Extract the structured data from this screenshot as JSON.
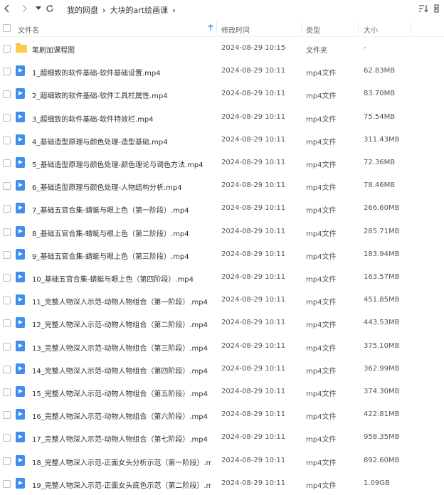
{
  "breadcrumb": [
    "我的网盘",
    "大块的art绘画课"
  ],
  "columns": {
    "name": "文件名",
    "modified": "修改时间",
    "type": "类型",
    "size": "大小"
  },
  "colors": {
    "accent": "#3f8ef0",
    "folder": "#ffcb4f"
  },
  "files": [
    {
      "icon": "folder-icon",
      "name": "笔刷加课程图",
      "time": "2024-08-29 10:15",
      "type": "文件夹",
      "size": "-"
    },
    {
      "icon": "mp4-icon",
      "name": "1_超细致的软件基础-软件基础设置.mp4",
      "time": "2024-08-29 10:11",
      "type": "mp4文件",
      "size": "62.83MB"
    },
    {
      "icon": "mp4-icon",
      "name": "2_超细致的软件基础-软件工具栏属性.mp4",
      "time": "2024-08-29 10:11",
      "type": "mp4文件",
      "size": "83.70MB"
    },
    {
      "icon": "mp4-icon",
      "name": "3_超细致的软件基础-软件特效栏.mp4",
      "time": "2024-08-29 10:11",
      "type": "mp4文件",
      "size": "75.54MB"
    },
    {
      "icon": "mp4-icon",
      "name": "4_基础造型原理与颜色处理-造型基础.mp4",
      "time": "2024-08-29 10:11",
      "type": "mp4文件",
      "size": "311.43MB"
    },
    {
      "icon": "mp4-icon",
      "name": "5_基础造型原理与颜色处理-颜色理论与调色方法.mp4",
      "time": "2024-08-29 10:11",
      "type": "mp4文件",
      "size": "72.36MB"
    },
    {
      "icon": "mp4-icon",
      "name": "6_基础造型原理与颜色处理-人物结构分析.mp4",
      "time": "2024-08-29 10:11",
      "type": "mp4文件",
      "size": "78.46MB"
    },
    {
      "icon": "mp4-icon",
      "name": "7_基础五官合集-蜻蜓与眼上色（第一阶段）.mp4",
      "time": "2024-08-29 10:11",
      "type": "mp4文件",
      "size": "266.60MB"
    },
    {
      "icon": "mp4-icon",
      "name": "8_基础五官合集-蜻蜓与眼上色（第二阶段）.mp4",
      "time": "2024-08-29 10:11",
      "type": "mp4文件",
      "size": "285.71MB"
    },
    {
      "icon": "mp4-icon",
      "name": "9_基础五官合集-蜻蜓与眼上色（第三阶段）.mp4",
      "time": "2024-08-29 10:11",
      "type": "mp4文件",
      "size": "183.94MB"
    },
    {
      "icon": "mp4-icon",
      "name": "10_基础五官合集-蜻蜓与眼上色（第四阶段）.mp4",
      "time": "2024-08-29 10:11",
      "type": "mp4文件",
      "size": "163.57MB"
    },
    {
      "icon": "mp4-icon",
      "name": "11_完整人物深入示范-动物人物组合（第一阶段）.mp4",
      "time": "2024-08-29 10:11",
      "type": "mp4文件",
      "size": "451.85MB"
    },
    {
      "icon": "mp4-icon",
      "name": "12_完整人物深入示范-动物人物组合（第二阶段）.mp4",
      "time": "2024-08-29 10:11",
      "type": "mp4文件",
      "size": "443.53MB"
    },
    {
      "icon": "mp4-icon",
      "name": "13_完整人物深入示范-动物人物组合（第三阶段）.mp4",
      "time": "2024-08-29 10:11",
      "type": "mp4文件",
      "size": "375.10MB"
    },
    {
      "icon": "mp4-icon",
      "name": "14_完整人物深入示范-动物人物组合（第四阶段）.mp4",
      "time": "2024-08-29 10:11",
      "type": "mp4文件",
      "size": "362.99MB"
    },
    {
      "icon": "mp4-icon",
      "name": "15_完整人物深入示范-动物人物组合（第五阶段）.mp4",
      "time": "2024-08-29 10:11",
      "type": "mp4文件",
      "size": "374.30MB"
    },
    {
      "icon": "mp4-icon",
      "name": "16_完整人物深入示范-动物人物组合（第六阶段）.mp4",
      "time": "2024-08-29 10:11",
      "type": "mp4文件",
      "size": "422.81MB"
    },
    {
      "icon": "mp4-icon",
      "name": "17_完整人物深入示范-动物人物组合（第七阶段）.mp4",
      "time": "2024-08-29 10:11",
      "type": "mp4文件",
      "size": "958.35MB"
    },
    {
      "icon": "mp4-icon",
      "name": "18_完整人物深入示范-正面女头分析示范（第一阶段）.m...",
      "time": "2024-08-29 10:11",
      "type": "mp4文件",
      "size": "892.60MB"
    },
    {
      "icon": "mp4-icon",
      "name": "19_完整人物深入示范-正面女头底色示范（第二阶段）.m...",
      "time": "2024-08-29 10:11",
      "type": "mp4文件",
      "size": "1.09GB"
    }
  ]
}
